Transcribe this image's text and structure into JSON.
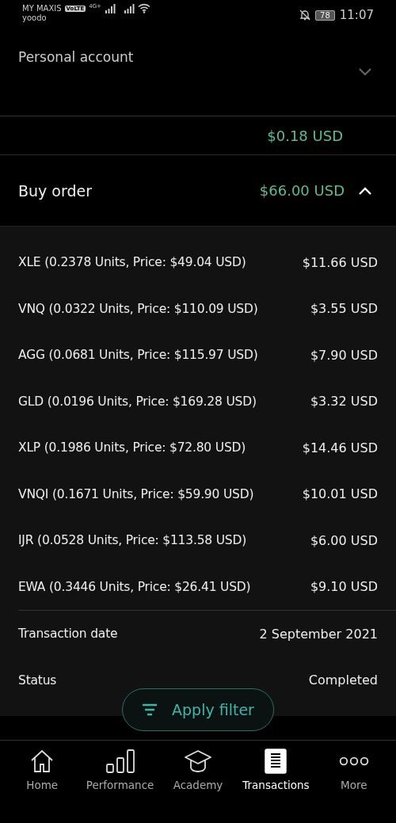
{
  "status_bar": {
    "carrier": "MY MAXIS",
    "carrier_badge": "VoLTE",
    "network": "4G+",
    "carrier_2": "yoodo",
    "battery": "78",
    "time": "11:07"
  },
  "header": {
    "title": "Personal account",
    "expanded": false
  },
  "dividend": {
    "amount": "$0.18 USD"
  },
  "order": {
    "title": "Buy order",
    "amount": "$66.00 USD",
    "expanded": true,
    "items": [
      {
        "label": "XLE (0.2378 Units, Price: $49.04 USD)",
        "amount": "$11.66 USD"
      },
      {
        "label": "VNQ (0.0322 Units, Price: $110.09 USD)",
        "amount": "$3.55 USD"
      },
      {
        "label": "AGG (0.0681 Units, Price: $115.97 USD)",
        "amount": "$7.90 USD"
      },
      {
        "label": "GLD (0.0196 Units, Price: $169.28 USD)",
        "amount": "$3.32 USD"
      },
      {
        "label": "XLP (0.1986 Units, Price: $72.80 USD)",
        "amount": "$14.46 USD"
      },
      {
        "label": "VNQI (0.1671 Units, Price: $59.90 USD)",
        "amount": "$10.01 USD"
      },
      {
        "label": "IJR (0.0528 Units, Price: $113.58 USD)",
        "amount": "$6.00 USD"
      },
      {
        "label": "EWA (0.3446 Units, Price: $26.41 USD)",
        "amount": "$9.10 USD"
      }
    ],
    "details": [
      {
        "label": "Transaction date",
        "value": "2 September 2021"
      },
      {
        "label": "Status",
        "value": "Completed"
      }
    ]
  },
  "filter_button": "Apply filter",
  "nav": [
    {
      "label": "Home",
      "kind": "home",
      "selected": false
    },
    {
      "label": "Performance",
      "kind": "bars",
      "selected": false
    },
    {
      "label": "Academy",
      "kind": "cap",
      "selected": false
    },
    {
      "label": "Transactions",
      "kind": "doc",
      "selected": true
    },
    {
      "label": "More",
      "kind": "dots",
      "selected": false
    }
  ]
}
